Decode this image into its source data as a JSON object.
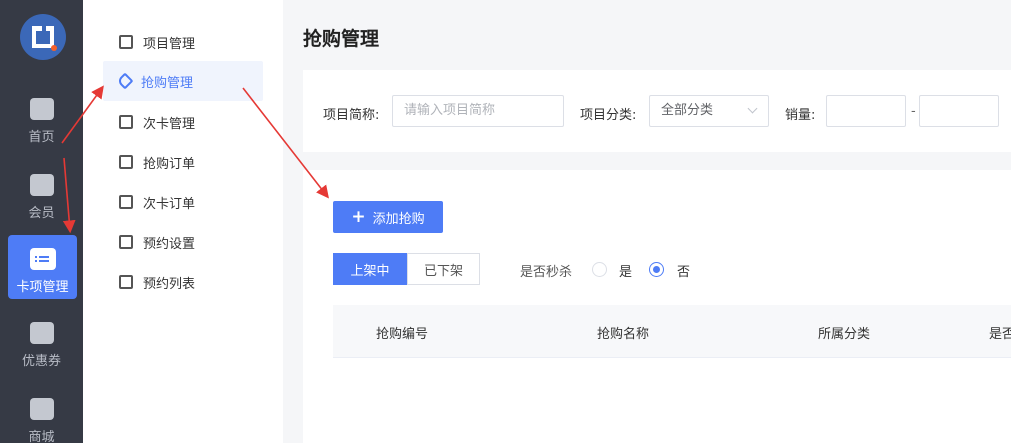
{
  "rail": {
    "items": [
      {
        "label": "首页",
        "icon": "home-icon"
      },
      {
        "label": "会员",
        "icon": "member-card-icon"
      },
      {
        "label": "卡项管理",
        "icon": "card-folder-icon"
      },
      {
        "label": "优惠券",
        "icon": "wallet-icon"
      },
      {
        "label": "商城",
        "icon": "shopping-bag-icon"
      }
    ]
  },
  "submenu": {
    "items": [
      {
        "label": "项目管理",
        "icon": "bookmark-icon"
      },
      {
        "label": "抢购管理",
        "icon": "tag-icon"
      },
      {
        "label": "次卡管理",
        "icon": "card-icon"
      },
      {
        "label": "抢购订单",
        "icon": "order-list-icon"
      },
      {
        "label": "次卡订单",
        "icon": "card-order-icon"
      },
      {
        "label": "预约设置",
        "icon": "hand-icon"
      },
      {
        "label": "预约列表",
        "icon": "schedule-list-icon"
      }
    ]
  },
  "main": {
    "title": "抢购管理",
    "filters": {
      "name_label": "项目简称:",
      "name_placeholder": "请输入项目简称",
      "category_label": "项目分类:",
      "category_value": "全部分类",
      "sales_label": "销量:",
      "sales_sep": "-"
    },
    "add_button": "添加抢购",
    "add_button_icon": "+",
    "tabs": [
      "上架中",
      "已下架"
    ],
    "flash_label": "是否秒杀",
    "radio_yes": "是",
    "radio_no": "否",
    "selected_radio": "否",
    "table_headers": [
      "抢购编号",
      "抢购名称",
      "所属分类",
      "是否"
    ]
  },
  "colors": {
    "accent": "#4e7cf6",
    "rail_bg": "#363a45",
    "arrow": "#e53935"
  }
}
